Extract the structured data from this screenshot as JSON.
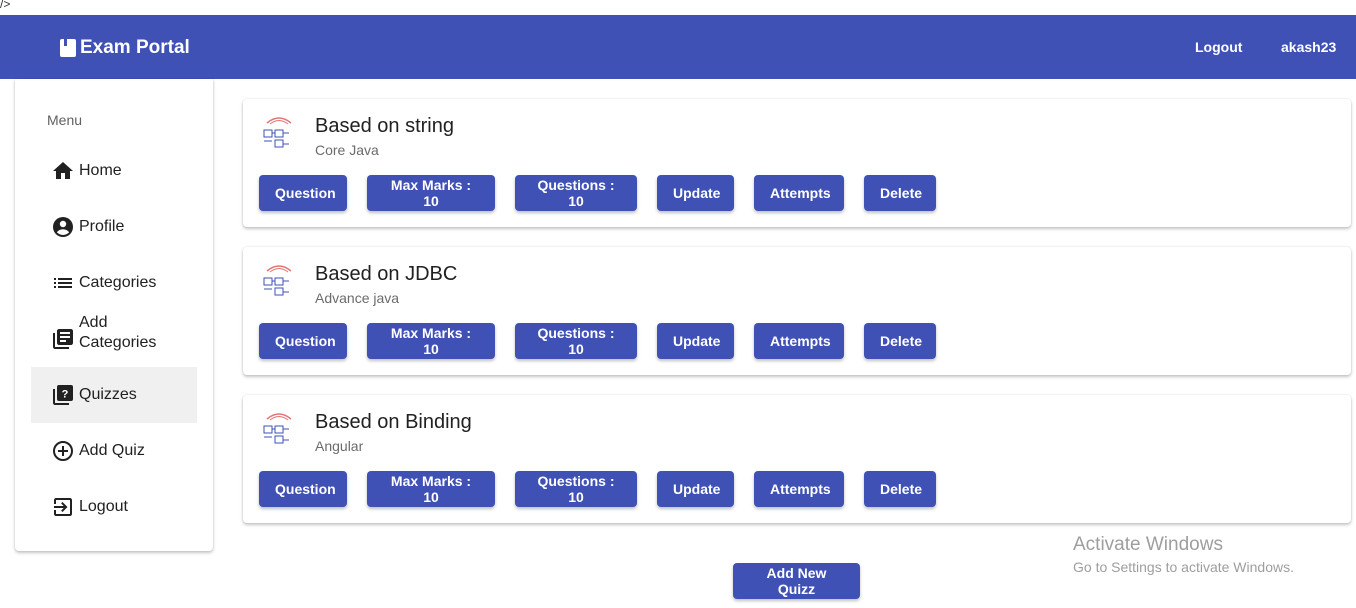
{
  "stray_text": "/>",
  "header": {
    "title": "Exam Portal",
    "logout_label": "Logout",
    "username": "akash23"
  },
  "sidebar": {
    "menu_title": "Menu",
    "items": [
      {
        "label": "Home",
        "icon": "home-icon"
      },
      {
        "label": "Profile",
        "icon": "account-circle-icon"
      },
      {
        "label": "Categories",
        "icon": "list-icon"
      },
      {
        "label": "Add Categories",
        "icon": "library-books-icon"
      },
      {
        "label": "Quizzes",
        "icon": "quiz-icon",
        "active": true
      },
      {
        "label": "Add Quiz",
        "icon": "add-circle-icon"
      },
      {
        "label": "Logout",
        "icon": "exit-to-app-icon"
      }
    ]
  },
  "quizzes": [
    {
      "title": "Based on string",
      "category": "Core Java",
      "question_label": "Question",
      "max_marks": "Max Marks : 10",
      "questions": "Questions : 10",
      "update_label": "Update",
      "attempts_label": "Attempts",
      "delete_label": "Delete"
    },
    {
      "title": "Based on JDBC",
      "category": "Advance java",
      "question_label": "Question",
      "max_marks": "Max Marks : 10",
      "questions": "Questions : 10",
      "update_label": "Update",
      "attempts_label": "Attempts",
      "delete_label": "Delete"
    },
    {
      "title": "Based on Binding",
      "category": "Angular",
      "question_label": "Question",
      "max_marks": "Max Marks : 10",
      "questions": "Questions : 10",
      "update_label": "Update",
      "attempts_label": "Attempts",
      "delete_label": "Delete"
    }
  ],
  "add_quiz_label": "Add New Quizz",
  "watermark": {
    "line1": "Activate Windows",
    "line2": "Go to Settings to activate Windows."
  },
  "colors": {
    "primary": "#3f51b5",
    "active_nav": "#f0f0f0"
  }
}
